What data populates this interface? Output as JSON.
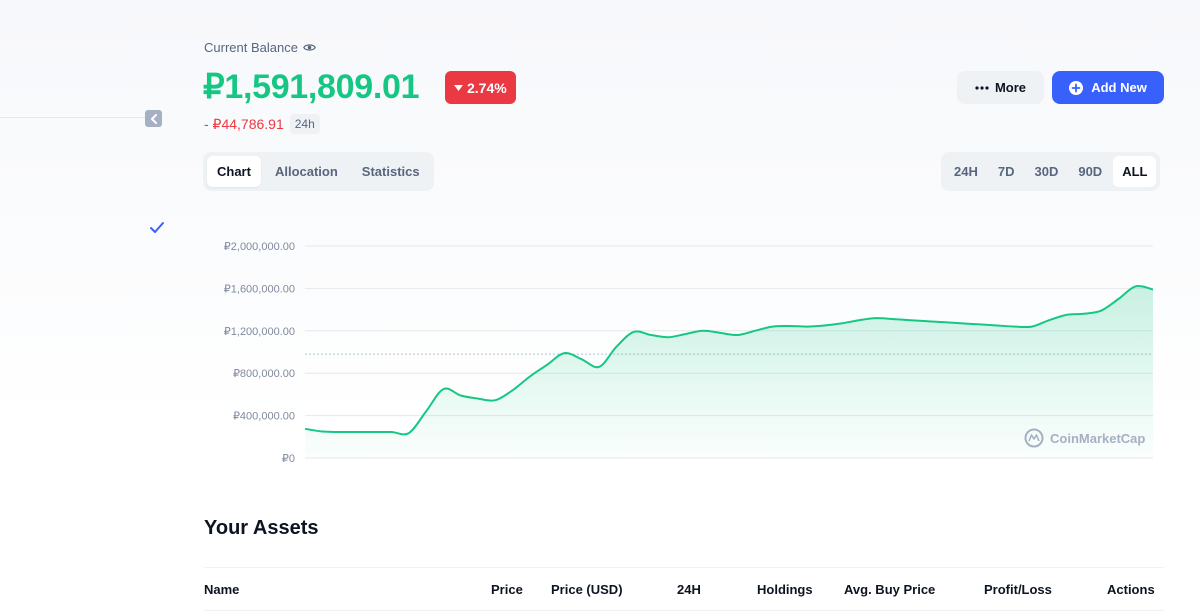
{
  "balance": {
    "label": "Current Balance",
    "value": "₽1,591,809.01",
    "change_percent": "2.74%",
    "change_amount": "- ₽44,786.91",
    "period": "24h"
  },
  "actions": {
    "more_label": "More",
    "add_label": "Add New"
  },
  "view_tabs": [
    {
      "label": "Chart",
      "active": true
    },
    {
      "label": "Allocation",
      "active": false
    },
    {
      "label": "Statistics",
      "active": false
    }
  ],
  "range_tabs": [
    {
      "label": "24H",
      "active": false
    },
    {
      "label": "7D",
      "active": false
    },
    {
      "label": "30D",
      "active": false
    },
    {
      "label": "90D",
      "active": false
    },
    {
      "label": "ALL",
      "active": true
    }
  ],
  "colors": {
    "positive": "#16c784",
    "negative": "#ea3943",
    "primary": "#3861fb"
  },
  "chart_data": {
    "type": "area",
    "ylim": [
      0,
      2000000
    ],
    "y_ticks": [
      {
        "value": 2000000,
        "label": "₽2,000,000.00"
      },
      {
        "value": 1600000,
        "label": "₽1,600,000.00"
      },
      {
        "value": 1200000,
        "label": "₽1,200,000.00"
      },
      {
        "value": 800000,
        "label": "₽800,000.00"
      },
      {
        "value": 400000,
        "label": "₽400,000.00"
      },
      {
        "value": 0,
        "label": "₽0"
      }
    ],
    "reference_value": 980000,
    "grid": true,
    "watermark": "CoinMarketCap",
    "series": [
      {
        "values": [
          275000,
          250000,
          245000,
          245000,
          245000,
          245000,
          235000,
          440000,
          650000,
          590000,
          560000,
          545000,
          640000,
          770000,
          880000,
          990000,
          930000,
          860000,
          1050000,
          1190000,
          1160000,
          1140000,
          1170000,
          1200000,
          1180000,
          1160000,
          1200000,
          1240000,
          1245000,
          1240000,
          1250000,
          1270000,
          1300000,
          1320000,
          1310000,
          1300000,
          1290000,
          1280000,
          1270000,
          1260000,
          1250000,
          1240000,
          1240000,
          1300000,
          1350000,
          1360000,
          1390000,
          1500000,
          1620000,
          1590000
        ]
      }
    ]
  },
  "assets": {
    "title": "Your Assets",
    "columns": [
      "Name",
      "Price",
      "Price (USD)",
      "24H",
      "Holdings",
      "Avg. Buy Price",
      "Profit/Loss",
      "Actions"
    ]
  }
}
